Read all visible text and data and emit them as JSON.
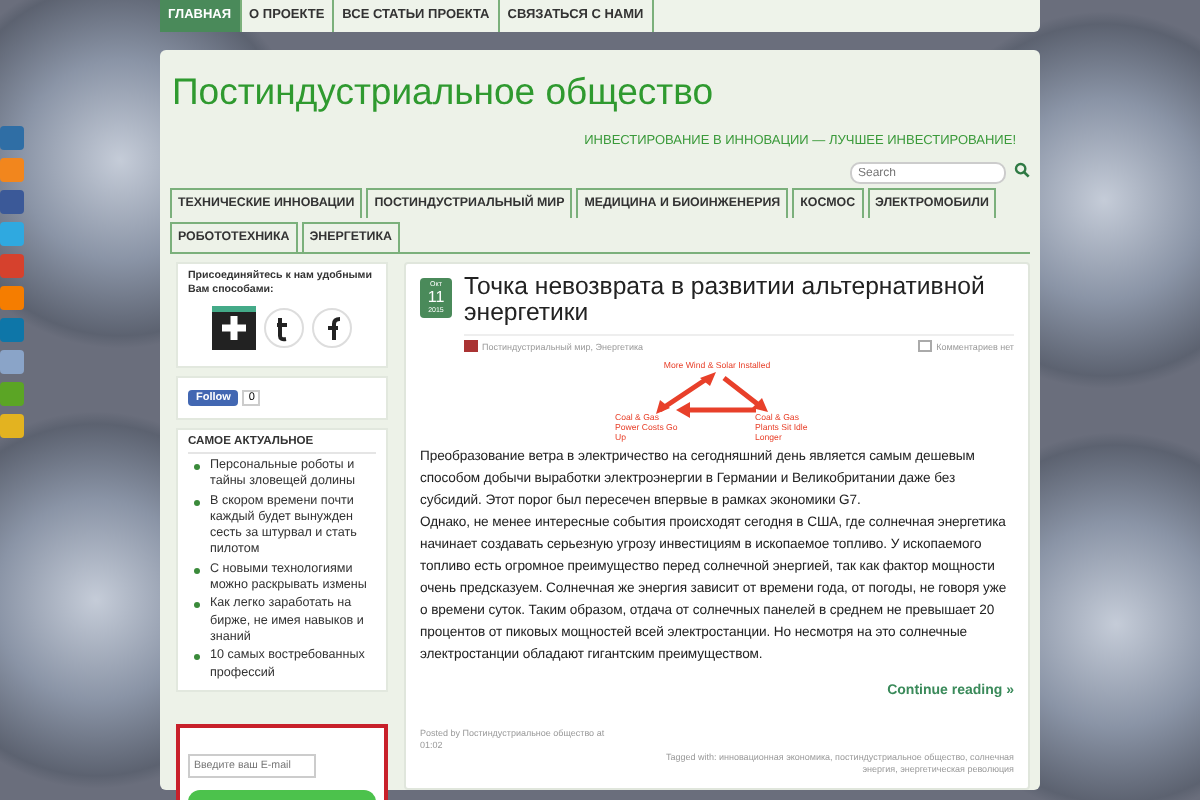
{
  "top_nav": [
    {
      "label": "ГЛАВНАЯ",
      "selected": true
    },
    {
      "label": "О ПРОЕКТЕ",
      "selected": false
    },
    {
      "label": "ВСЕ СТАТЬИ ПРОЕКТА",
      "selected": false
    },
    {
      "label": "СВЯЗАТЬСЯ С НАМИ",
      "selected": false
    }
  ],
  "site": {
    "title": "Постиндустриальное общество",
    "tagline": "ИНВЕСТИРОВАНИЕ В ИННОВАЦИИ — ЛУЧШЕЕ ИНВЕСТИРОВАНИЕ!",
    "search_placeholder": "Search"
  },
  "categories": [
    "ТЕХНИЧЕСКИЕ ИННОВАЦИИ",
    "ПОСТИНДУСТРИАЛЬНЫЙ МИР",
    "МЕДИЦИНА И БИОИНЖЕНЕРИЯ",
    "КОСМОС",
    "ЭЛЕКТРОМОБИЛИ",
    "РОБОТОТЕХНИКА",
    "ЭНЕРГЕТИКА"
  ],
  "share_bar": [
    {
      "color": "#2f6ea5"
    },
    {
      "color": "#f2861d"
    },
    {
      "color": "#3b5998"
    },
    {
      "color": "#2fa9e0"
    },
    {
      "color": "#d6412d"
    },
    {
      "color": "#f57d00"
    },
    {
      "color": "#0e76a8"
    },
    {
      "color": "#8aa4c8"
    },
    {
      "color": "#5ba525"
    },
    {
      "color": "#e3b320"
    }
  ],
  "sidebar": {
    "join_title": "Присоединяйтесь к нам удобными Вам способами:",
    "follow_label": "Follow",
    "follow_count": "0",
    "popular_title": "САМОЕ АКТУАЛЬНОЕ",
    "popular": [
      "Персональные роботы и тайны зловещей долины",
      "В скором времени почти каждый будет вынужден сесть за штурвал и стать пилотом",
      "С новыми технологиями можно раскрывать измены",
      "Как легко заработать на бирже, не имея навыков и знаний",
      "10 самых востребованных профессий"
    ],
    "email_placeholder": "Введите ваш E-mail"
  },
  "post": {
    "month": "Окт",
    "day": "11",
    "year": "2015",
    "title": "Точка невозврата в развитии альтернативной энергетики",
    "categories": "Постиндустриальный мир, Энергетика",
    "comments": "Комментариев нет",
    "figure_labels": [
      "More Wind & Solar Installed",
      "Coal & Gas Power Costs Go Up",
      "Coal & Gas Plants Sit Idle Longer"
    ],
    "body": " Преобразование ветра в электричество на сегодняшний день является самым дешевым способом добычи выработки электроэнергии в Германии и Великобритании даже без субсидий. Этот порог был пересечен впервые в рамках экономики G7.\nОднако, не менее интересные события происходят сегодня в США, где солнечная энергетика начинает создавать серьезную угрозу инвестициям в ископаемое топливо. У ископаемого топливо есть огромное преимущество перед солнечной энергией, так как фактор мощности очень предсказуем. Солнечная же энергия зависит от времени года, от погоды, не говоря уже о времени суток. Таким образом, отдача от солнечных панелей в среднем не превышает 20 процентов от пиковых мощностей всей электростанции. Но несмотря на это солнечные электростанции обладают гигантским преимуществом.",
    "more": "Continue reading »",
    "posted": "Posted by Постиндустриальное общество at 01:02",
    "tags": "Tagged with: инновационная экономика, постиндустриальное общество, солнечная энергия, энергетическая революция"
  }
}
